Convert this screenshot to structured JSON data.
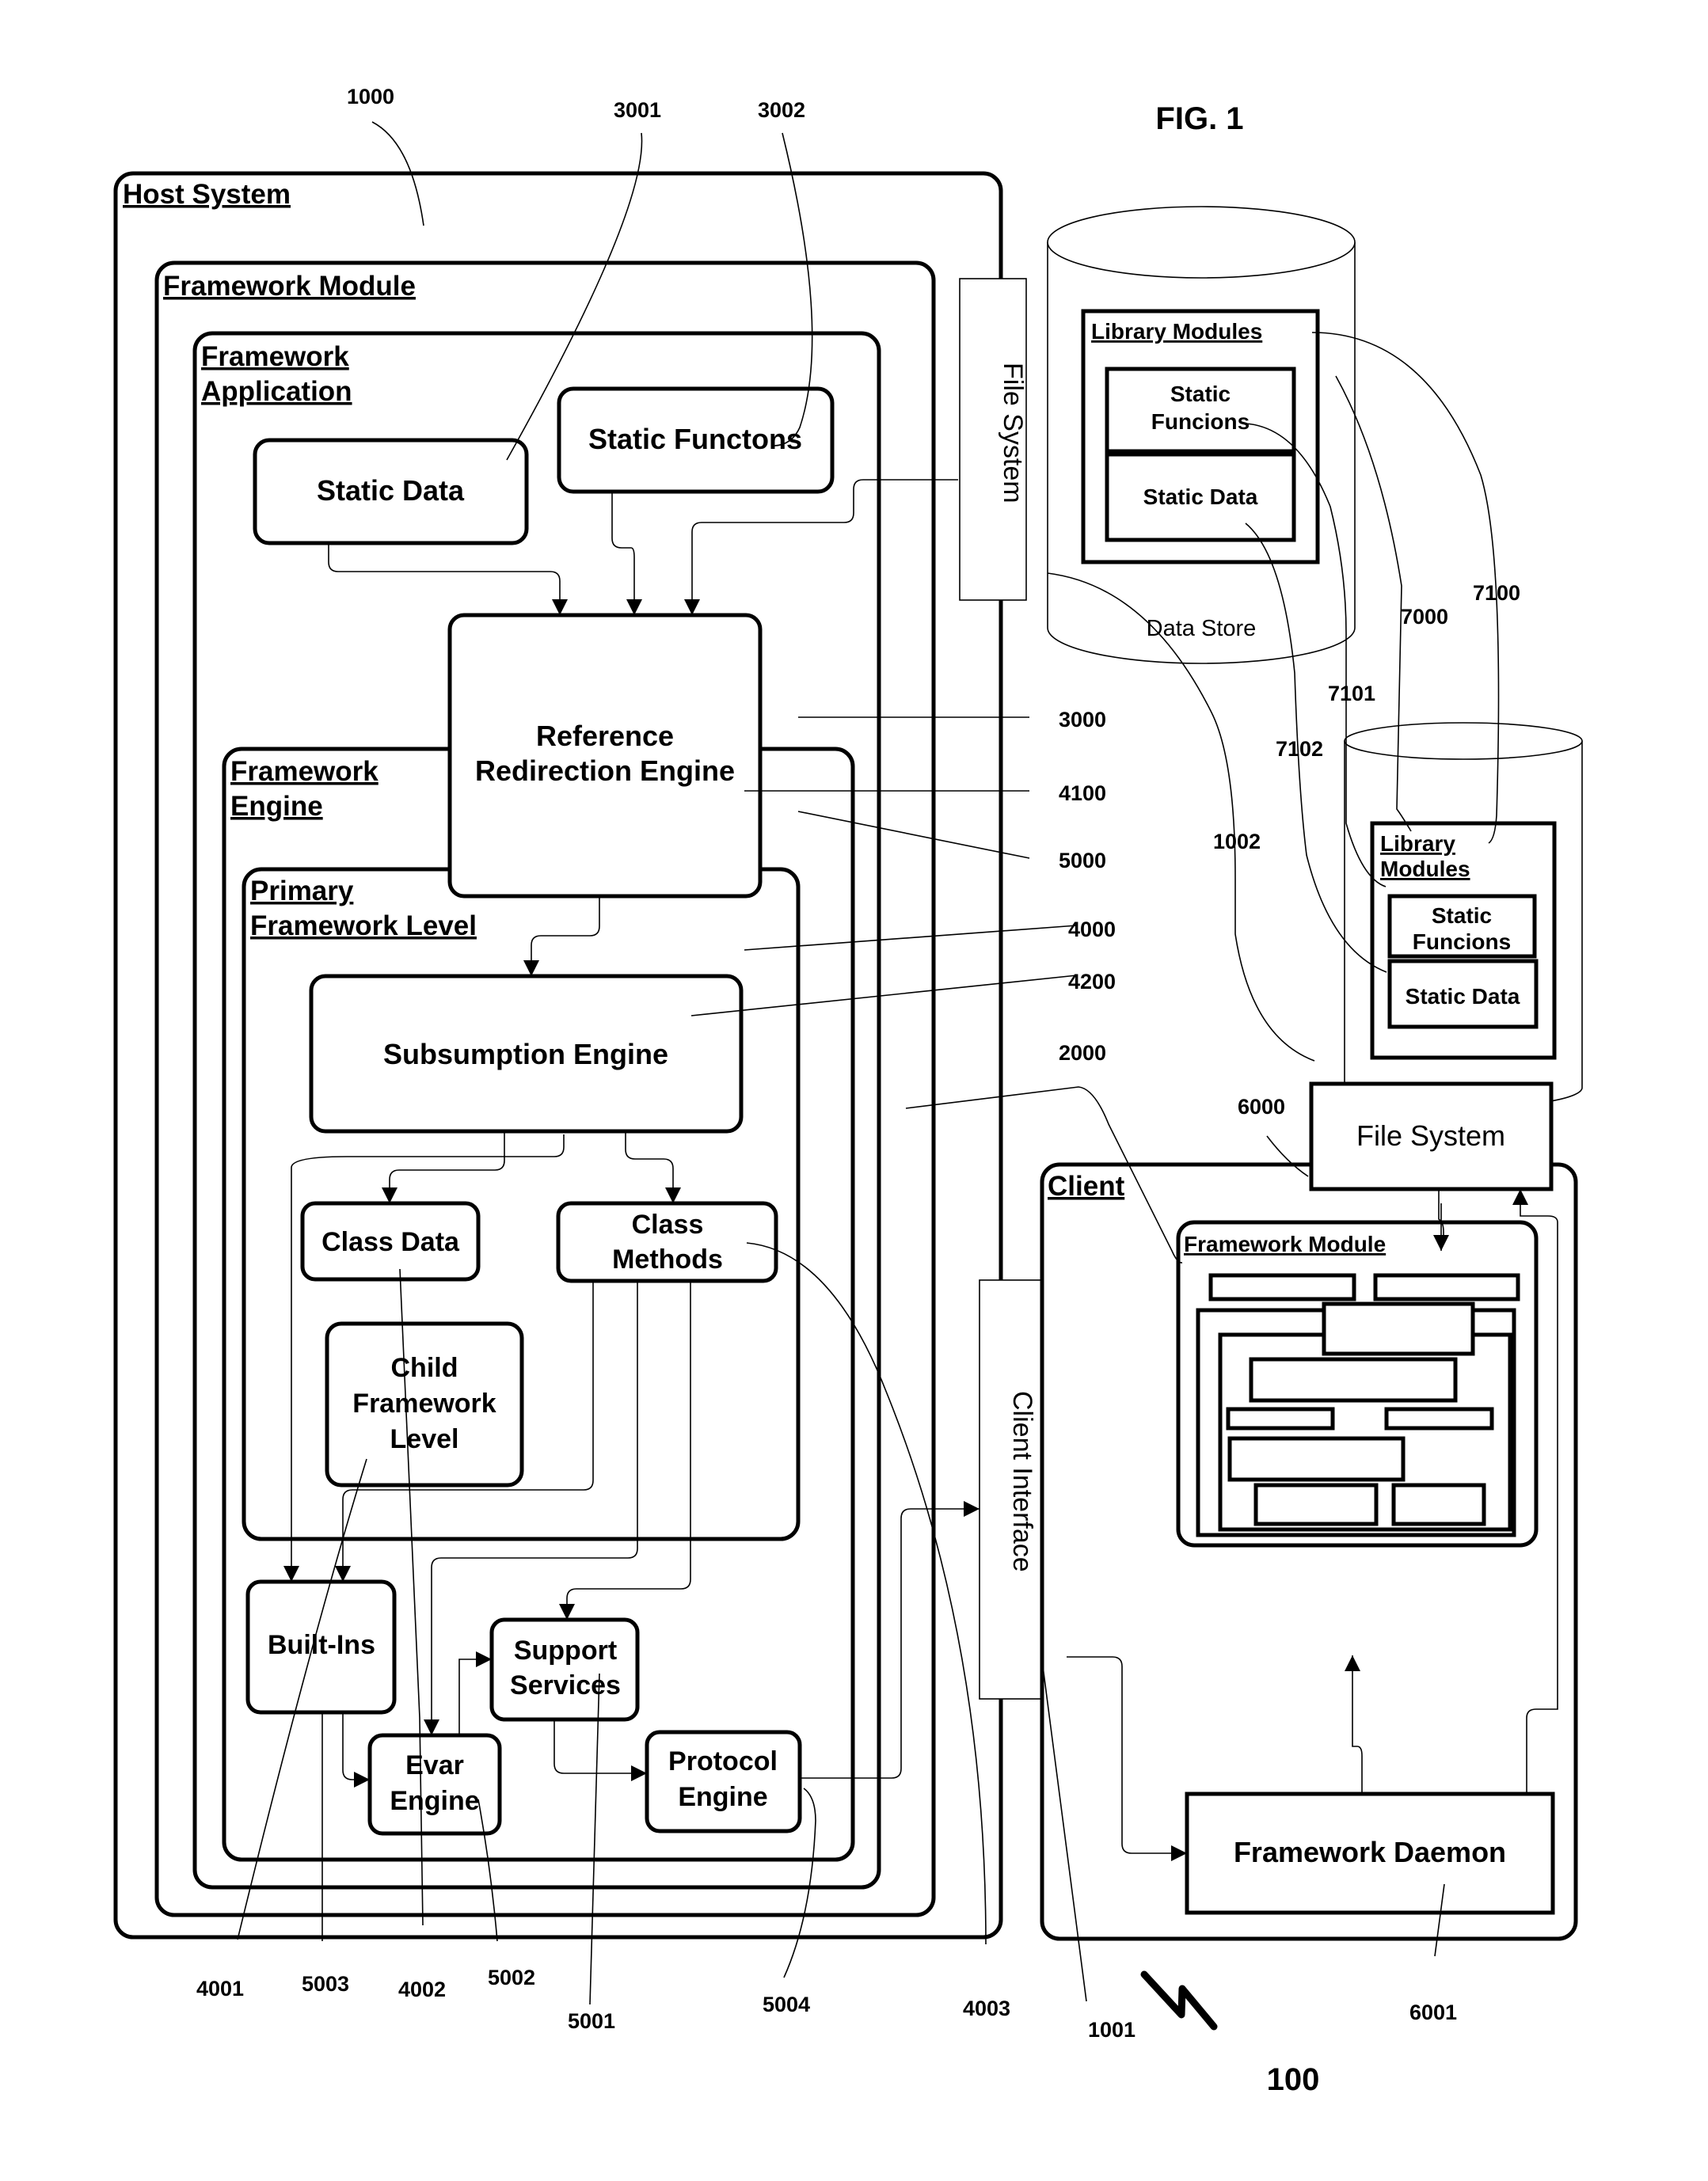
{
  "figure": {
    "title": "FIG. 1",
    "system_ref": "100"
  },
  "host_system": {
    "label": "Host System",
    "framework_module": "Framework Module",
    "framework_application": [
      "Framework",
      "Application"
    ],
    "static_data": "Static Data",
    "static_functions": "Static Functons",
    "reference_redirection_engine": [
      "Reference",
      "Redirection Engine"
    ],
    "framework_engine": [
      "Framework",
      "Engine"
    ],
    "primary_framework_level": [
      "Primary",
      "Framework Level"
    ],
    "subsumption_engine": "Subsumption Engine",
    "class_data": "Class Data",
    "class_methods": [
      "Class",
      "Methods"
    ],
    "child_framework_level": [
      "Child",
      "Framework",
      "Level"
    ],
    "built_ins": "Built-Ins",
    "support_services": [
      "Support",
      "Services"
    ],
    "evar_engine": [
      "Evar",
      "Engine"
    ],
    "protocol_engine": [
      "Protocol",
      "Engine"
    ]
  },
  "file_system_host": "File System",
  "client_interface": "Client Interface",
  "data_store": {
    "label": "Data Store",
    "library_modules": "Library Modules",
    "static_functions": [
      "Static",
      "Funcions"
    ],
    "static_data": "Static Data"
  },
  "client_store": {
    "library_modules": [
      "Library",
      "Modules"
    ],
    "static_functions": [
      "Static",
      "Funcions"
    ],
    "static_data": "Static Data"
  },
  "client": {
    "label": "Client",
    "file_system": "File System",
    "framework_module": "Framework Module",
    "framework_daemon": "Framework Daemon"
  },
  "refs": {
    "r1000": "1000",
    "r3001": "3001",
    "r3002": "3002",
    "r3000": "3000",
    "r4100": "4100",
    "r5000": "5000",
    "r4000": "4000",
    "r4200": "4200",
    "r2000": "2000",
    "r7000": "7000",
    "r7100": "7100",
    "r7101": "7101",
    "r7102": "7102",
    "r1002": "1002",
    "r6000": "6000",
    "r4001": "4001",
    "r5003": "5003",
    "r4002": "4002",
    "r5002": "5002",
    "r5001": "5001",
    "r5004": "5004",
    "r4003": "4003",
    "r1001": "1001",
    "r6001": "6001"
  }
}
